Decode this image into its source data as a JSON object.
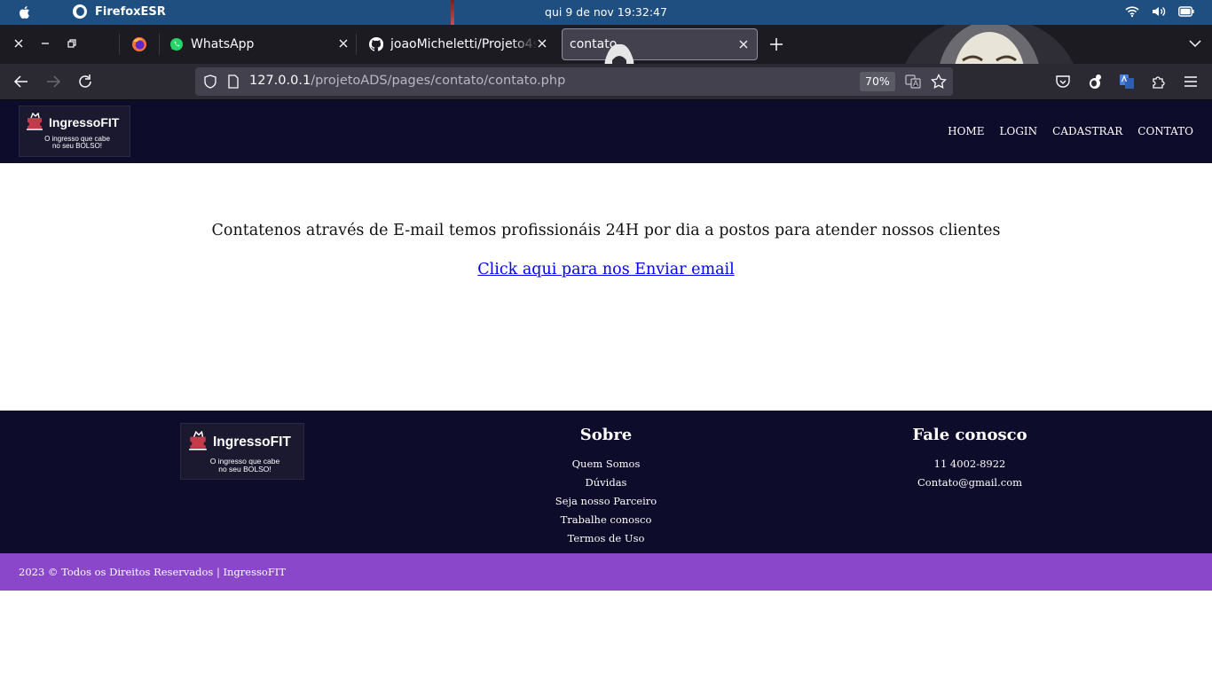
{
  "os_bar": {
    "app_name": "FirefoxESR",
    "datetime": "qui 9 de nov  19:32:47"
  },
  "tabs": [
    {
      "title": "WhatsApp",
      "icon": "whatsapp-icon"
    },
    {
      "title": "joaoMicheletti/Projeto4s",
      "icon": "github-icon"
    },
    {
      "title": "contato",
      "icon": "none",
      "active": true
    }
  ],
  "navbar": {
    "url_host": "127.0.0.1",
    "url_path": "/projetoADS/pages/contato/contato.php",
    "zoom": "70%"
  },
  "site": {
    "brand": "IngressoFIT",
    "tagline": "O ingresso que cabe no seu BOLSO!",
    "nav": [
      "HOME",
      "LOGIN",
      "CADASTRAR",
      "CONTATO"
    ],
    "main_text": "Contatenos através de E-mail temos profissionáis 24H por dia a postos para atender nossos clientes",
    "email_link": "Click aqui para nos Enviar email",
    "footer": {
      "sobre_title": "Sobre",
      "sobre_links": [
        "Quem Somos",
        "Dúvidas",
        "Seja nosso Parceiro",
        "Trabalhe conosco",
        "Termos de Uso"
      ],
      "fale_title": "Fale conosco",
      "fale_items": [
        "11 4002-8922",
        "Contato@gmail.com"
      ]
    },
    "copyright": "2023 © Todos os Direitos Reservados | IngressoFIT"
  },
  "colors": {
    "os_bar": "#1f4f80",
    "browser_dark": "#1c1b22",
    "site_dark": "#0e0c2b",
    "copyright_bar": "#8a47c9",
    "link": "#0000ee"
  }
}
